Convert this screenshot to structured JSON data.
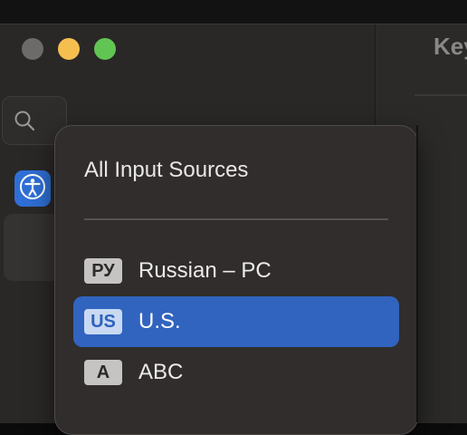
{
  "window": {
    "main_title": "Key"
  },
  "popup": {
    "header": "All Input Sources",
    "items": [
      {
        "badge": "РУ",
        "label": "Russian – PC",
        "selected": false
      },
      {
        "badge": "US",
        "label": "U.S.",
        "selected": true
      },
      {
        "badge": "A",
        "label": "ABC",
        "selected": false
      }
    ]
  },
  "colors": {
    "selection": "#3164bf",
    "close": "#6d6b69",
    "minimize": "#f4bf4f",
    "zoom": "#61c554",
    "accessibility_icon_bg": "#2f6fd6"
  }
}
